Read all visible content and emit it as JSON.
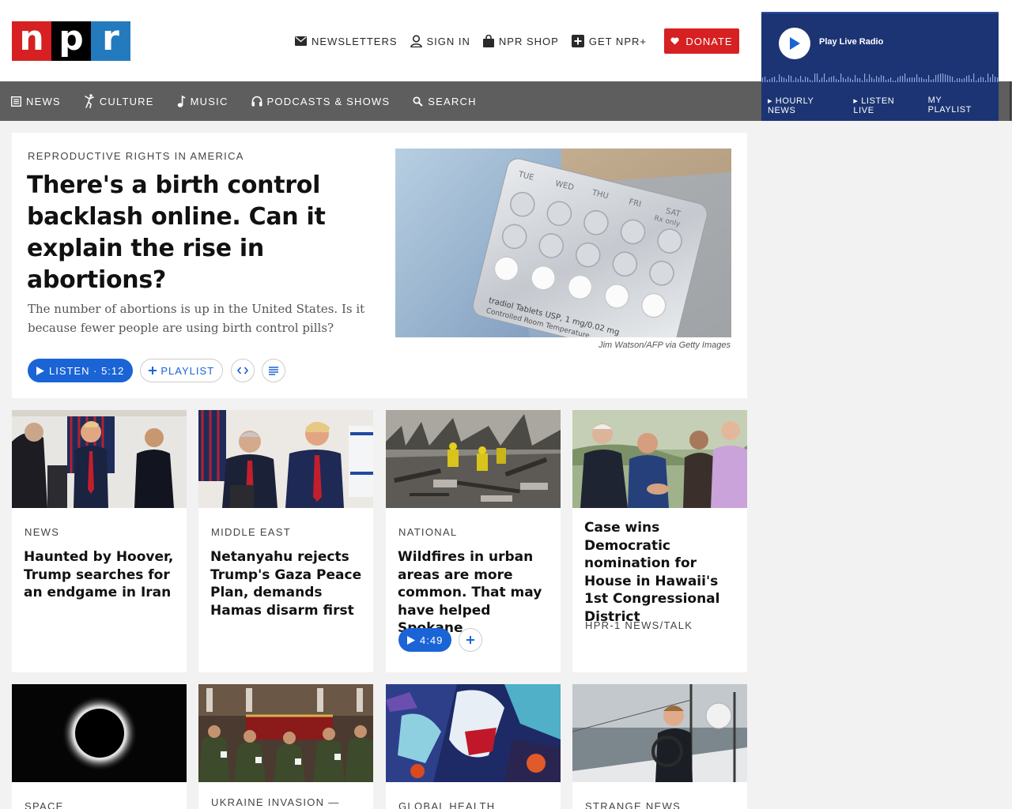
{
  "logo": {
    "letters": [
      "n",
      "p",
      "r"
    ]
  },
  "utility": {
    "newsletters": "NEWSLETTERS",
    "sign_in": "SIGN IN",
    "shop": "NPR SHOP",
    "get_plus": "GET NPR+",
    "donate": "DONATE"
  },
  "nav": {
    "items": [
      "NEWS",
      "CULTURE",
      "MUSIC",
      "PODCASTS & SHOWS",
      "SEARCH"
    ]
  },
  "player": {
    "label": "Play Live Radio",
    "links": [
      "HOURLY NEWS",
      "LISTEN LIVE",
      "MY PLAYLIST"
    ]
  },
  "hero": {
    "slug": "REPRODUCTIVE RIGHTS IN AMERICA",
    "title": "There's a birth control backlash online. Can it explain the rise in abortions?",
    "teaser": "The number of abortions is up in the United States. Is it because fewer people are using birth control pills?",
    "listen": "LISTEN · 5:12",
    "playlist": "PLAYLIST",
    "credit": "Jim Watson/AFP via Getty Images",
    "pack_days": [
      "TUE",
      "WED",
      "THU",
      "FRI",
      "SAT"
    ],
    "pack_note": "Rx only",
    "pack_text": "tradiol Tablets USP, 1 mg/0.02 mg",
    "pack_text2": "Controlled Room Temperature"
  },
  "cards": [
    {
      "slug": "NEWS",
      "title": "Haunted by Hoover, Trump searches for an endgame in Iran"
    },
    {
      "slug": "MIDDLE EAST",
      "title": "Netanyahu rejects Trump's Gaza Peace Plan, demands Hamas disarm first"
    },
    {
      "slug": "NATIONAL",
      "title": "Wildfires in urban areas are more common. That may have helped Spokane",
      "listen": "4:49"
    },
    {
      "title": "Case wins Democratic nomination for House in Hawaii's 1st Congressional District",
      "slug": "HPR-1 NEWS/TALK"
    }
  ],
  "cards_row2": [
    {
      "slug": "SPACE"
    },
    {
      "slug": "UKRAINE INVASION —"
    },
    {
      "slug": "GLOBAL HEALTH"
    },
    {
      "slug": "STRANGE NEWS"
    }
  ],
  "colors": {
    "npr_red": "#d62021",
    "npr_blue": "#237bbd",
    "nav_gray": "#5e5e5e",
    "player_navy": "#1c3473",
    "action_blue": "#1a64d6"
  }
}
